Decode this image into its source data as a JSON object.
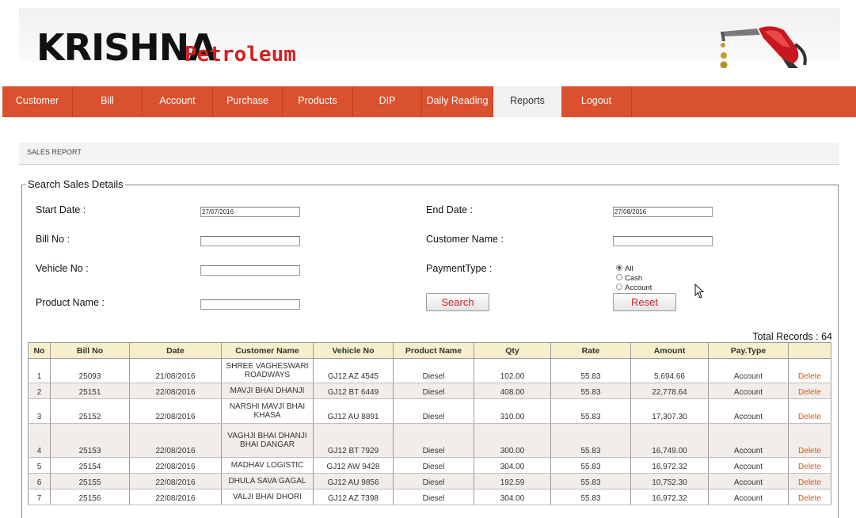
{
  "brand": {
    "name": "KRISHNA",
    "sub": "Petroleum"
  },
  "nav": [
    "Customer",
    "Bill",
    "Account",
    "Purchase",
    "Products",
    "DIP",
    "Daily Reading",
    "Reports",
    "Logout"
  ],
  "nav_active": "Reports",
  "breadcrumb": "SALES REPORT",
  "form": {
    "legend": "Search Sales Details",
    "start_date_label": "Start Date :",
    "start_date_value": "27/07/2016",
    "end_date_label": "End Date :",
    "end_date_value": "27/08/2016",
    "bill_no_label": "Bill No :",
    "customer_name_label": "Customer Name :",
    "vehicle_no_label": "Vehicle No :",
    "payment_type_label": "PaymentType :",
    "payment_options": [
      "All",
      "Cash",
      "Account"
    ],
    "payment_selected": "All",
    "product_name_label": "Product Name :",
    "search_label": "Search",
    "reset_label": "Reset"
  },
  "total_records": "Total Records : 64",
  "table": {
    "headers": [
      "No",
      "Bill No",
      "Date",
      "Customer Name",
      "Vehicle No",
      "Product Name",
      "Qty",
      "Rate",
      "Amount",
      "Pay.Type",
      ""
    ],
    "rows": [
      [
        "1",
        "25093",
        "21/08/2016",
        "SHREE VAGHESWARI ROADWAYS",
        "GJ12 AZ 4545",
        "Diesel",
        "102.00",
        "55.83",
        "5,694.66",
        "Account",
        "Delete"
      ],
      [
        "2",
        "25151",
        "22/08/2016",
        "MAVJI BHAI DHANJI",
        "GJ12 BT 6449",
        "Diesel",
        "408.00",
        "55.83",
        "22,778.64",
        "Account",
        "Delete"
      ],
      [
        "3",
        "25152",
        "22/08/2016",
        "NARSHI MAVJI BHAI KHASA",
        "GJ12 AU 8891",
        "Diesel",
        "310.00",
        "55.83",
        "17,307.30",
        "Account",
        "Delete"
      ],
      [
        "4",
        "25153",
        "22/08/2016",
        "VAGHJI BHAI DHANJI BHAI DANGAR",
        "GJ12 BT 7929",
        "Diesel",
        "300.00",
        "55.83",
        "16,749.00",
        "Account",
        "Delete"
      ],
      [
        "5",
        "25154",
        "22/08/2016",
        "MADHAV LOGISTIC",
        "GJ12 AW 9428",
        "Diesel",
        "304.00",
        "55.83",
        "16,972.32",
        "Account",
        "Delete"
      ],
      [
        "6",
        "25155",
        "22/08/2016",
        "DHULA SAVA GAGAL",
        "GJ12 AU 9856",
        "Diesel",
        "192.59",
        "55.83",
        "10,752.30",
        "Account",
        "Delete"
      ],
      [
        "7",
        "25156",
        "22/08/2016",
        "VALJI BHAI DHORI",
        "GJ12 AZ 7398",
        "Diesel",
        "304.00",
        "55.83",
        "16,972.32",
        "Account",
        "Delete"
      ]
    ]
  }
}
